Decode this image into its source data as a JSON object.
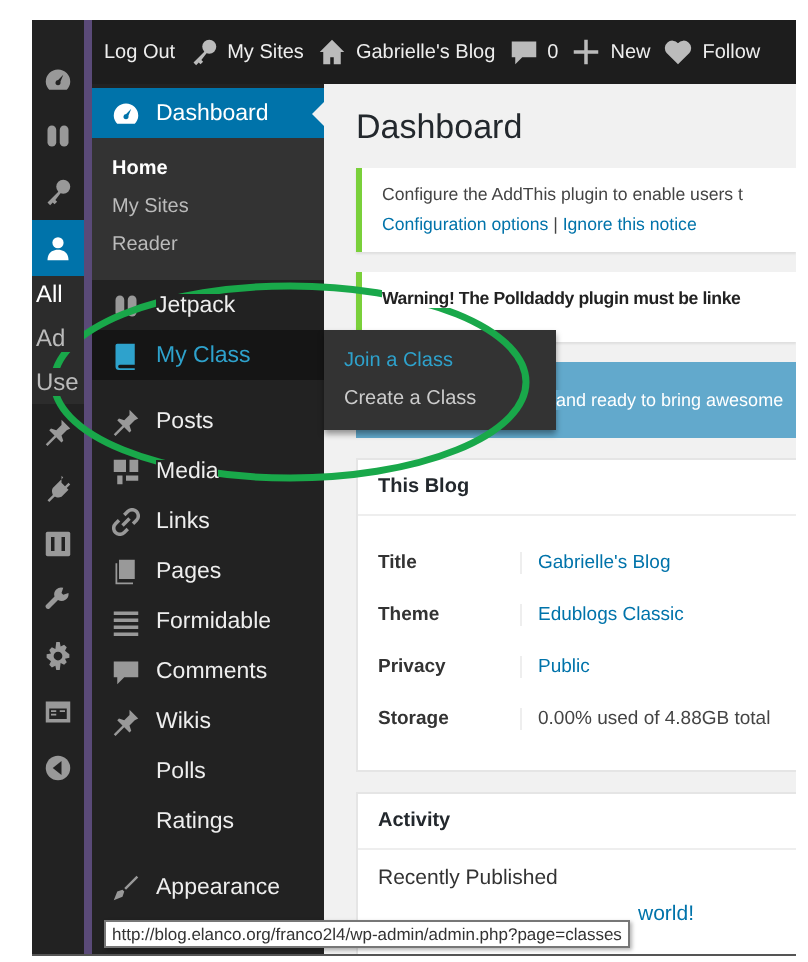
{
  "icon_rail": {
    "items": [
      {
        "selected": false
      },
      {
        "selected": false
      },
      {
        "selected": false
      },
      {
        "selected": true
      },
      {
        "selected": false
      },
      {
        "selected": false
      },
      {
        "selected": false
      },
      {
        "selected": false
      },
      {
        "selected": false
      },
      {
        "selected": false
      },
      {
        "selected": false
      }
    ],
    "submenu": [
      "All",
      "Ad",
      "Use"
    ]
  },
  "admin_bar": {
    "items": [
      {
        "label": "Log Out"
      },
      {
        "label": "My Sites"
      },
      {
        "label": "Gabrielle's Blog"
      },
      {
        "label": "0"
      },
      {
        "label": "New"
      },
      {
        "label": "Follow"
      }
    ]
  },
  "sidebar": {
    "items": [
      {
        "kind": "menu",
        "label": "Dashboard",
        "selected": true,
        "expanded": false,
        "children": [
          {
            "label": "Home",
            "selected": true
          },
          {
            "label": "My Sites",
            "selected": false
          },
          {
            "label": "Reader",
            "selected": false
          }
        ]
      },
      {
        "kind": "menu",
        "label": "Jetpack",
        "selected": false,
        "expanded": false
      },
      {
        "kind": "menu",
        "label": "My Class",
        "selected": false,
        "expanded": true,
        "children": [
          {
            "label": "Join a Class",
            "selected": true
          },
          {
            "label": "Create a Class",
            "selected": false
          }
        ]
      },
      {
        "kind": "separator"
      },
      {
        "kind": "menu",
        "label": "Posts",
        "selected": false,
        "expanded": false
      },
      {
        "kind": "menu",
        "label": "Media",
        "selected": false,
        "expanded": false
      },
      {
        "kind": "menu",
        "label": "Links",
        "selected": false,
        "expanded": false
      },
      {
        "kind": "menu",
        "label": "Pages",
        "selected": false,
        "expanded": false
      },
      {
        "kind": "menu",
        "label": "Formidable",
        "selected": false,
        "expanded": false
      },
      {
        "kind": "menu",
        "label": "Comments",
        "selected": false,
        "expanded": false
      },
      {
        "kind": "menu",
        "label": "Wikis",
        "selected": false,
        "expanded": false
      },
      {
        "kind": "menu",
        "label": "Polls",
        "selected": false,
        "expanded": false
      },
      {
        "kind": "menu",
        "label": "Ratings",
        "selected": false,
        "expanded": false
      },
      {
        "kind": "separator"
      },
      {
        "kind": "menu",
        "label": "Appearance",
        "selected": false,
        "expanded": false
      }
    ]
  },
  "content": {
    "title": "Dashboard",
    "notices": [
      {
        "kind": "info",
        "text": "Configure the AddThis plugin to enable users t",
        "links": [
          "Configuration options",
          "Ignore this notice"
        ],
        "link_separator": "|"
      },
      {
        "kind": "warning",
        "text": "Warning! The Polldaddy plugin must be linke"
      },
      {
        "kind": "banner",
        "text": "and ready to bring awesome"
      }
    ],
    "this_blog": {
      "title": "This Blog",
      "rows": [
        {
          "label": "Title",
          "value": "Gabrielle's Blog",
          "link": true
        },
        {
          "label": "Theme",
          "value": "Edublogs Classic",
          "link": true
        },
        {
          "label": "Privacy",
          "value": "Public",
          "link": true
        },
        {
          "label": "Storage",
          "value": "0.00% used of 4.88GB total",
          "link": false
        }
      ]
    },
    "activity": {
      "title": "Activity",
      "subtitle": "Recently Published",
      "link": "world!"
    }
  },
  "status_tooltip": "http://blog.elanco.org/franco2l4/wp-admin/admin.php?page=classes"
}
